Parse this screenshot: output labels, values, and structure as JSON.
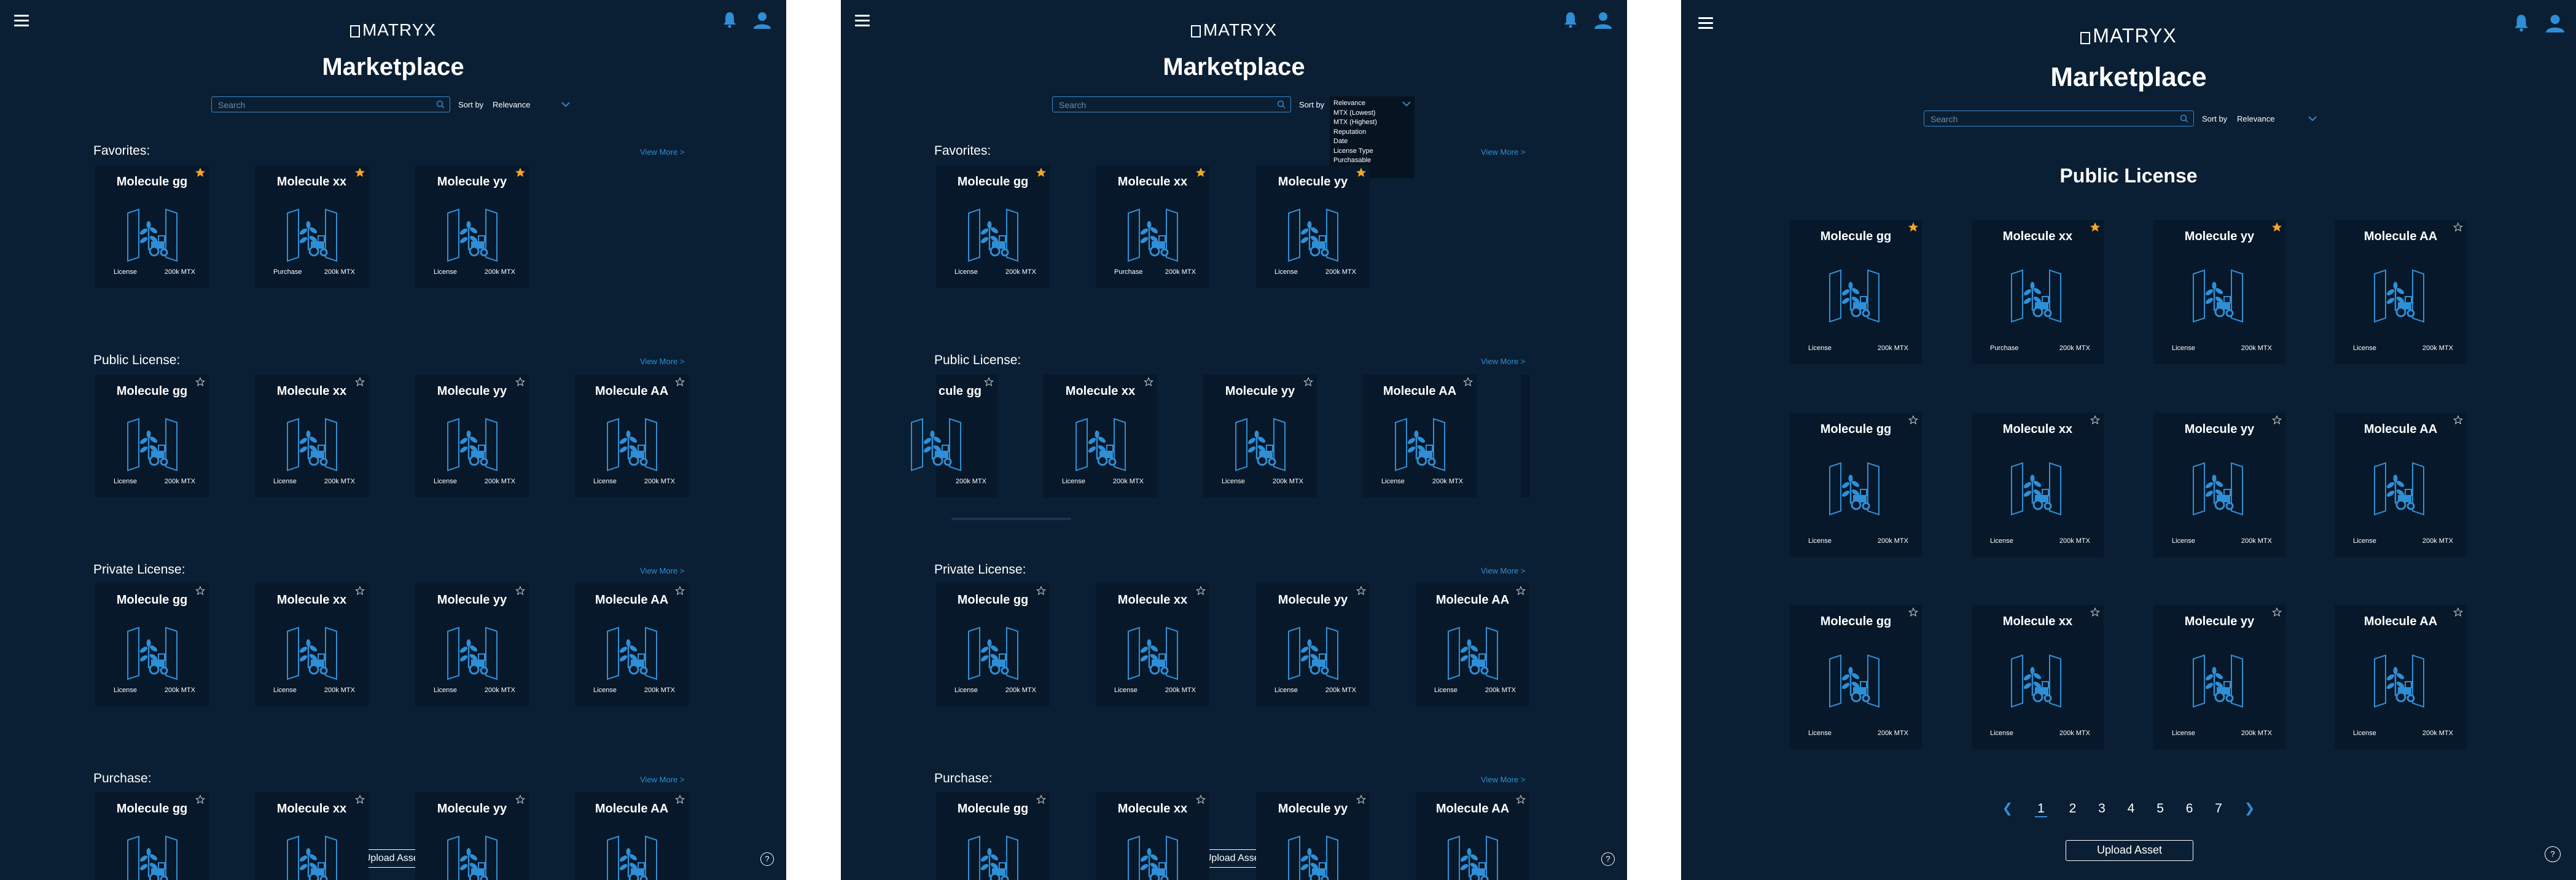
{
  "brand": {
    "name": "MATRYX"
  },
  "page": {
    "title": "Marketplace"
  },
  "search": {
    "placeholder": "Search"
  },
  "sort": {
    "label": "Sort by",
    "value": "Relevance",
    "options": [
      "Relevance",
      "MTX (Lowest)",
      "MTX (Highest)",
      "Reputation",
      "Date",
      "License Type",
      "Purchasable"
    ]
  },
  "sections": {
    "favorites": {
      "title": "Favorites:",
      "view_more": "View More >",
      "cards": [
        {
          "name": "Molecule gg",
          "type": "License",
          "price": "200k MTX",
          "starred": true
        },
        {
          "name": "Molecule xx",
          "type": "Purchase",
          "price": "200k MTX",
          "starred": true
        },
        {
          "name": "Molecule yy",
          "type": "License",
          "price": "200k MTX",
          "starred": true
        }
      ]
    },
    "public": {
      "title": "Public License:",
      "view_more": "View More >",
      "cards": [
        {
          "name": "Molecule gg",
          "type": "License",
          "price": "200k MTX",
          "starred": false
        },
        {
          "name": "Molecule xx",
          "type": "License",
          "price": "200k MTX",
          "starred": false
        },
        {
          "name": "Molecule yy",
          "type": "License",
          "price": "200k MTX",
          "starred": false
        },
        {
          "name": "Molecule AA",
          "type": "License",
          "price": "200k MTX",
          "starred": false
        }
      ]
    },
    "private": {
      "title": "Private License:",
      "view_more": "View More >",
      "cards": [
        {
          "name": "Molecule gg",
          "type": "License",
          "price": "200k MTX",
          "starred": false
        },
        {
          "name": "Molecule xx",
          "type": "License",
          "price": "200k MTX",
          "starred": false
        },
        {
          "name": "Molecule yy",
          "type": "License",
          "price": "200k MTX",
          "starred": false
        },
        {
          "name": "Molecule AA",
          "type": "License",
          "price": "200k MTX",
          "starred": false
        }
      ]
    },
    "purchase": {
      "title": "Purchase:",
      "view_more": "View More >",
      "cards": [
        {
          "name": "Molecule gg",
          "starred": false
        },
        {
          "name": "Molecule xx",
          "starred": false
        },
        {
          "name": "Molecule yy",
          "starred": false
        },
        {
          "name": "Molecule AA",
          "starred": false
        }
      ]
    }
  },
  "public_page": {
    "title": "Public License",
    "rows": [
      [
        {
          "name": "Molecule gg",
          "type": "License",
          "price": "200k MTX",
          "starred": true
        },
        {
          "name": "Molecule xx",
          "type": "Purchase",
          "price": "200k MTX",
          "starred": true
        },
        {
          "name": "Molecule yy",
          "type": "License",
          "price": "200k MTX",
          "starred": true
        },
        {
          "name": "Molecule AA",
          "type": "License",
          "price": "200k MTX",
          "starred": false
        }
      ],
      [
        {
          "name": "Molecule gg",
          "type": "License",
          "price": "200k MTX",
          "starred": false
        },
        {
          "name": "Molecule xx",
          "type": "License",
          "price": "200k MTX",
          "starred": false
        },
        {
          "name": "Molecule yy",
          "type": "License",
          "price": "200k MTX",
          "starred": false
        },
        {
          "name": "Molecule AA",
          "type": "License",
          "price": "200k MTX",
          "starred": false
        }
      ],
      [
        {
          "name": "Molecule gg",
          "type": "License",
          "price": "200k MTX",
          "starred": false
        },
        {
          "name": "Molecule xx",
          "type": "License",
          "price": "200k MTX",
          "starred": false
        },
        {
          "name": "Molecule yy",
          "type": "License",
          "price": "200k MTX",
          "starred": false
        },
        {
          "name": "Molecule AA",
          "type": "License",
          "price": "200k MTX",
          "starred": false
        }
      ]
    ]
  },
  "scrolled_public_first": {
    "name": "cule gg"
  },
  "pagination": {
    "pages": [
      "1",
      "2",
      "3",
      "4",
      "5",
      "6",
      "7"
    ],
    "current": "1"
  },
  "upload": {
    "label": "Upload Asset"
  },
  "help": {
    "label": "?"
  },
  "icons": {
    "menu": "menu-icon",
    "bell": "bell-icon",
    "user": "user-icon",
    "search": "search-icon",
    "star": "star-icon",
    "help": "help-icon"
  },
  "colors": {
    "background": "#0a1f33",
    "card": "#07182a",
    "accent": "#2f8fd6",
    "star_gold": "#f5a623",
    "star_empty": "#c8c8c8"
  }
}
